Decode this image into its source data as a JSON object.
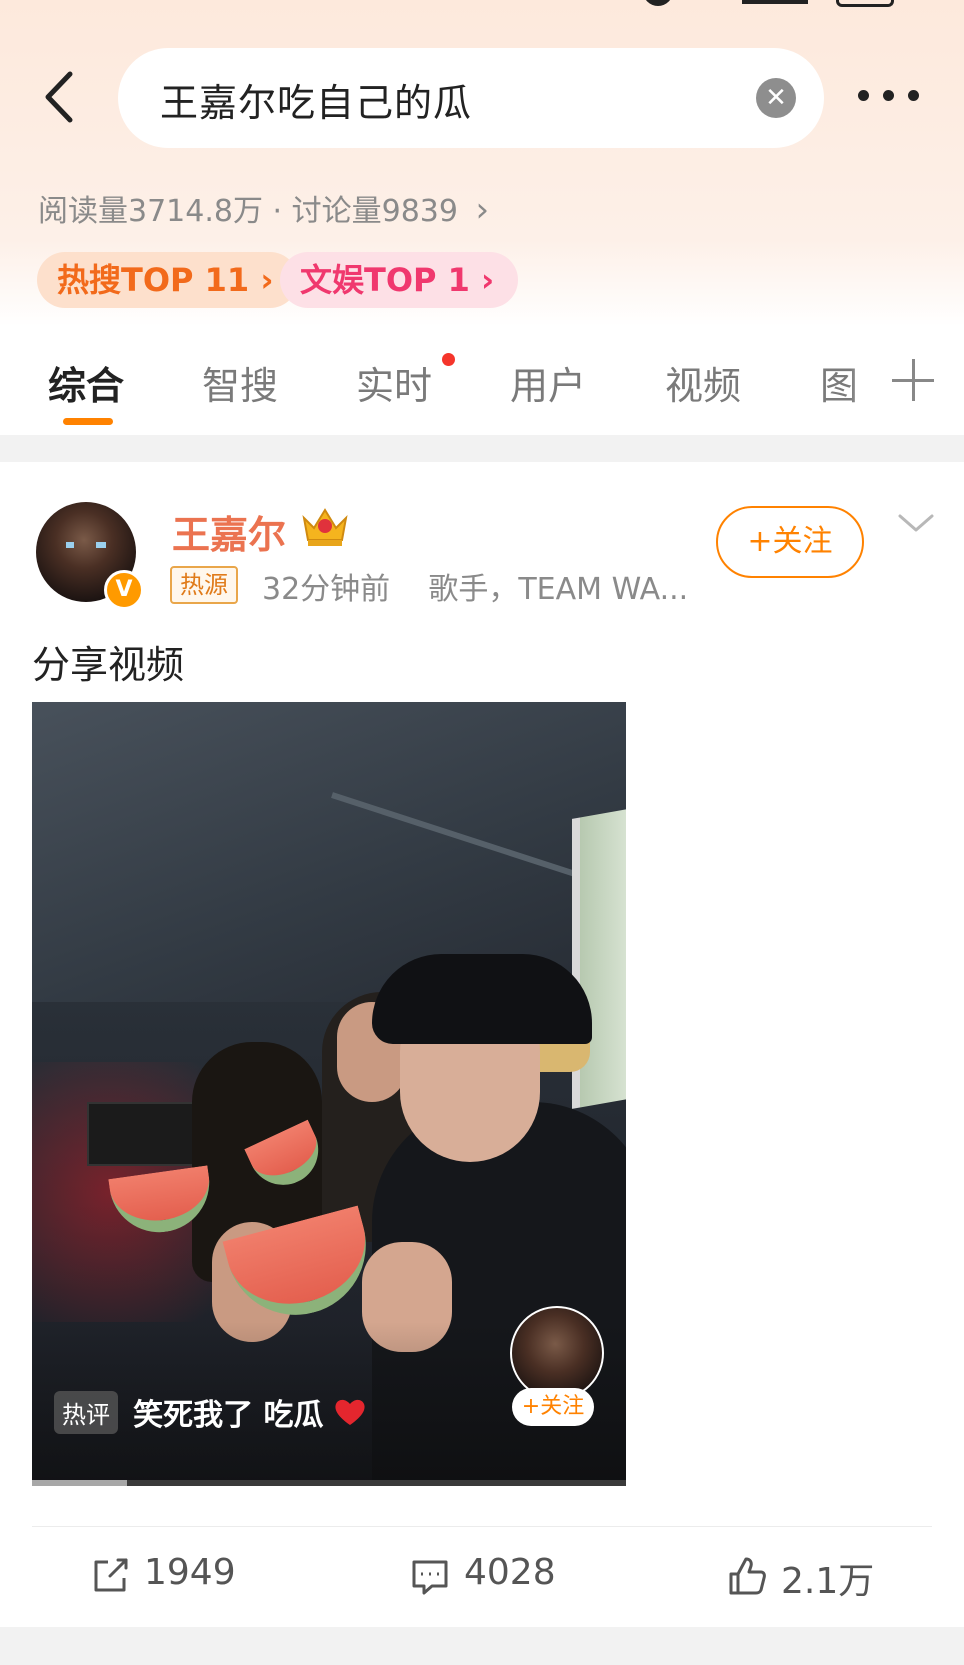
{
  "search": {
    "query": "王嘉尔吃自己的瓜"
  },
  "topic": {
    "reads_label": "阅读量3714.8万",
    "separator": "·",
    "discussions_label": "讨论量9839",
    "badges": [
      {
        "label": "热搜TOP 11",
        "color": "#f26a1b"
      },
      {
        "label": "文娱TOP 1",
        "color": "#f0386e"
      }
    ]
  },
  "tabs": [
    {
      "label": "综合",
      "active": true
    },
    {
      "label": "智搜",
      "active": false
    },
    {
      "label": "实时",
      "active": false,
      "dot": true
    },
    {
      "label": "用户",
      "active": false
    },
    {
      "label": "视频",
      "active": false
    },
    {
      "label": "图",
      "active": false
    }
  ],
  "post": {
    "author": "王嘉尔",
    "verified_icon": "v-badge-icon",
    "hot_tag": "热源",
    "time": "32分钟前",
    "bio": "歌手，TEAM WA...",
    "follow_label": "+关注",
    "text": "分享视频",
    "video": {
      "comment_tag": "热评",
      "comment_text": "笑死我了 吃瓜",
      "follow_label": "+关注",
      "progress": 0.16
    },
    "actions": {
      "reposts": "1949",
      "comments": "4028",
      "likes": "2.1万"
    }
  },
  "colors": {
    "accent": "#ff8200",
    "username": "#eb7350",
    "hot_badge": "#f26a1b",
    "ent_badge": "#f0386e"
  }
}
